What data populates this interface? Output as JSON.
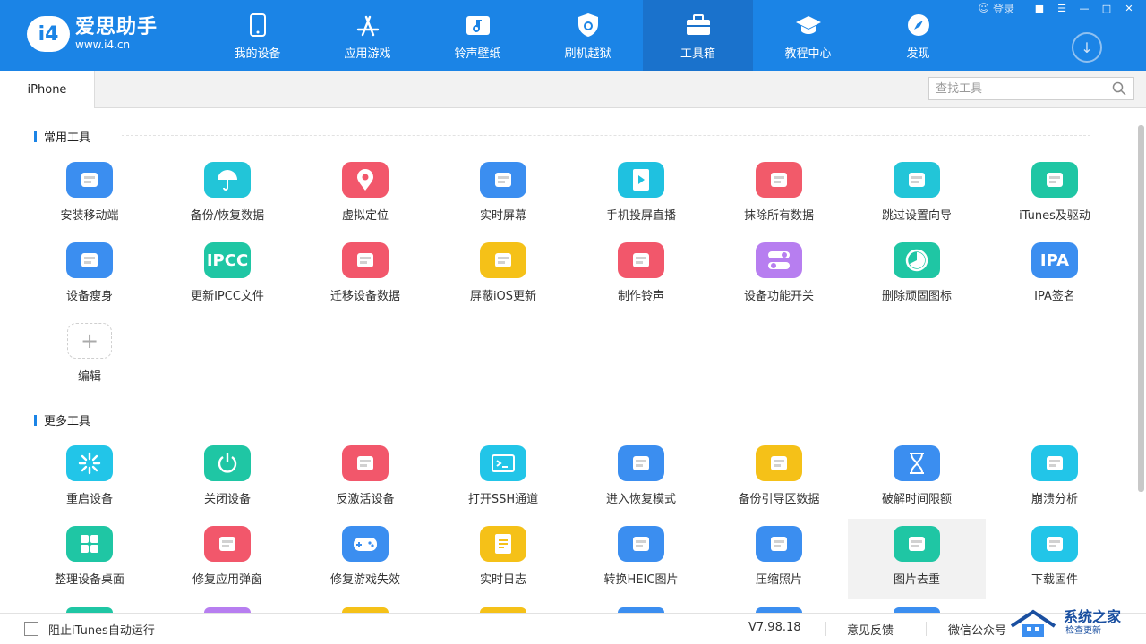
{
  "app": {
    "logo_badge": "i4",
    "logo_name": "爱思助手",
    "logo_url": "www.i4.cn"
  },
  "nav": [
    {
      "label": "我的设备",
      "icon": "phone-icon"
    },
    {
      "label": "应用游戏",
      "icon": "app-store-icon"
    },
    {
      "label": "铃声壁纸",
      "icon": "music-note-icon"
    },
    {
      "label": "刷机越狱",
      "icon": "shield-icon"
    },
    {
      "label": "工具箱",
      "icon": "toolbox-icon",
      "active": true
    },
    {
      "label": "教程中心",
      "icon": "graduation-cap-icon"
    },
    {
      "label": "发现",
      "icon": "compass-icon"
    }
  ],
  "window": {
    "login": "登录"
  },
  "tab": {
    "label": "iPhone"
  },
  "search": {
    "placeholder": "查找工具"
  },
  "sections": {
    "common": {
      "title": "常用工具",
      "tools": [
        {
          "label": "安装移动端",
          "icon": "i4-app-icon",
          "color": "#3b8ef0"
        },
        {
          "label": "备份/恢复数据",
          "icon": "umbrella-icon",
          "color": "#22c5d8"
        },
        {
          "label": "虚拟定位",
          "icon": "location-pin-icon",
          "color": "#f2576b"
        },
        {
          "label": "实时屏幕",
          "icon": "screen-mirror-icon",
          "color": "#3b8ef0"
        },
        {
          "label": "手机投屏直播",
          "icon": "play-screen-icon",
          "color": "#1fc1e0"
        },
        {
          "label": "抹除所有数据",
          "icon": "eraser-icon",
          "color": "#f25a6a"
        },
        {
          "label": "跳过设置向导",
          "icon": "skip-setup-icon",
          "color": "#22c5d8"
        },
        {
          "label": "iTunes及驱动",
          "icon": "itunes-icon",
          "color": "#1fc6a4"
        },
        {
          "label": "设备瘦身",
          "icon": "broom-icon",
          "color": "#3b8ef0",
          "text": ""
        },
        {
          "label": "更新IPCC文件",
          "icon": "ipcc-icon",
          "color": "#1fc6a4",
          "text": "IPCC"
        },
        {
          "label": "迁移设备数据",
          "icon": "migrate-icon",
          "color": "#f2576b"
        },
        {
          "label": "屏蔽iOS更新",
          "icon": "gear-block-icon",
          "color": "#f5c118"
        },
        {
          "label": "制作铃声",
          "icon": "ringtone-icon",
          "color": "#f2576b"
        },
        {
          "label": "设备功能开关",
          "icon": "toggle-icon",
          "color": "#b77ef0"
        },
        {
          "label": "删除顽固图标",
          "icon": "pie-icon",
          "color": "#1fc6a4"
        },
        {
          "label": "IPA签名",
          "icon": "ipa-icon",
          "color": "#3b8ef0",
          "text": "IPA"
        }
      ],
      "edit_label": "编辑",
      "edit_glyph": "+"
    },
    "more": {
      "title": "更多工具",
      "tools": [
        {
          "label": "重启设备",
          "icon": "restart-icon",
          "color": "#22c5e8"
        },
        {
          "label": "关闭设备",
          "icon": "power-icon",
          "color": "#1fc6a4"
        },
        {
          "label": "反激活设备",
          "icon": "deactivate-icon",
          "color": "#f2576b"
        },
        {
          "label": "打开SSH通道",
          "icon": "terminal-icon",
          "color": "#22c5e8"
        },
        {
          "label": "进入恢复模式",
          "icon": "recovery-icon",
          "color": "#3b8ef0"
        },
        {
          "label": "备份引导区数据",
          "icon": "boot-backup-icon",
          "color": "#f5c118"
        },
        {
          "label": "破解时间限额",
          "icon": "hourglass-icon",
          "color": "#3b8ef0"
        },
        {
          "label": "崩溃分析",
          "icon": "crash-report-icon",
          "color": "#22c5e8"
        },
        {
          "label": "整理设备桌面",
          "icon": "grid-icon",
          "color": "#1fc6a4"
        },
        {
          "label": "修复应用弹窗",
          "icon": "wrench-icon",
          "color": "#f2576b"
        },
        {
          "label": "修复游戏失效",
          "icon": "gamepad-icon",
          "color": "#3b8ef0"
        },
        {
          "label": "实时日志",
          "icon": "log-icon",
          "color": "#f5c118"
        },
        {
          "label": "转换HEIC图片",
          "icon": "heic-convert-icon",
          "color": "#3b8ef0"
        },
        {
          "label": "压缩照片",
          "icon": "compress-photo-icon",
          "color": "#3b8ef0"
        },
        {
          "label": "图片去重",
          "icon": "dedupe-photo-icon",
          "color": "#1fc6a4",
          "hover": true
        },
        {
          "label": "下载固件",
          "icon": "download-firmware-icon",
          "color": "#22c5e8"
        }
      ]
    }
  },
  "status": {
    "block_itunes": "阻止iTunes自动运行",
    "version": "V7.98.18",
    "feedback": "意见反馈",
    "wechat": "微信公众号",
    "watermark_title": "系统之家",
    "watermark_sub": "检查更新"
  }
}
